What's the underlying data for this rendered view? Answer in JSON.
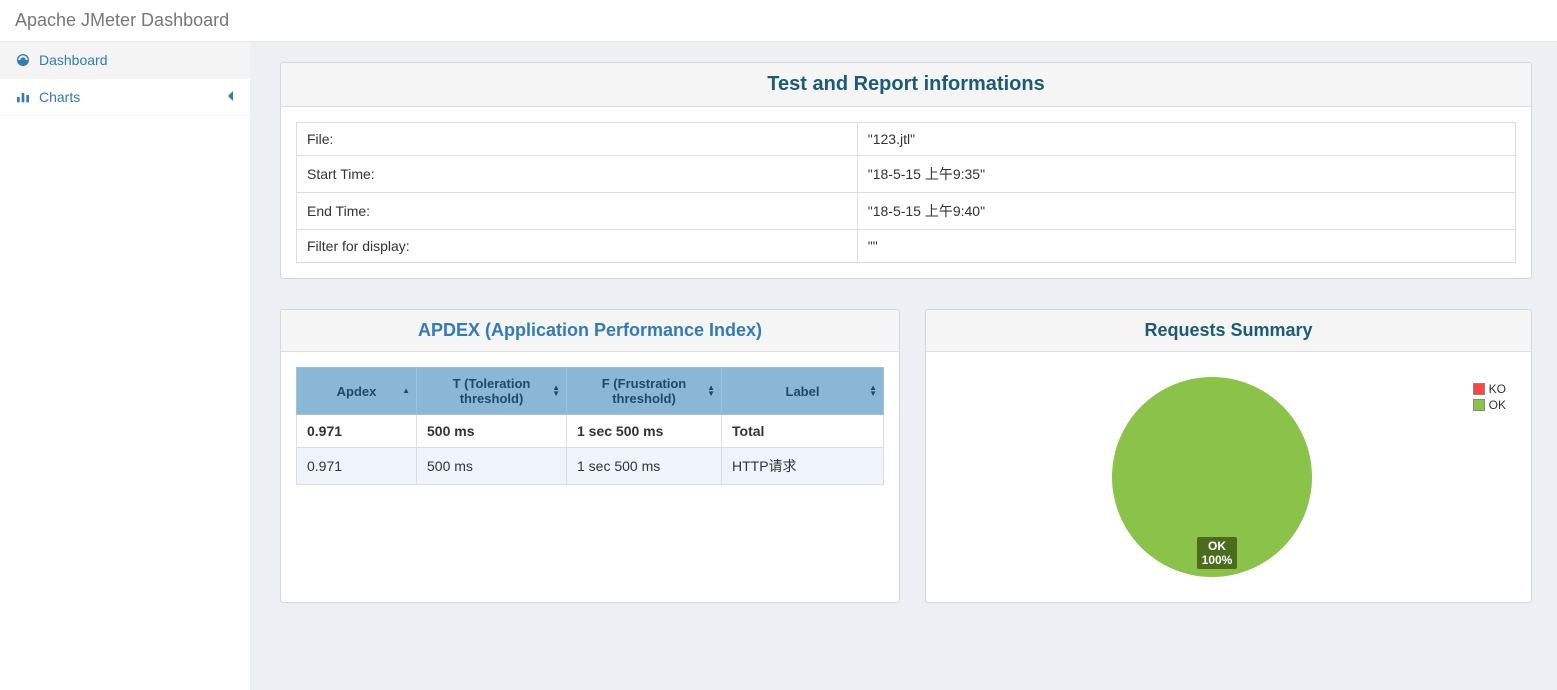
{
  "header": {
    "title": "Apache JMeter Dashboard"
  },
  "sidebar": {
    "dashboard": "Dashboard",
    "charts": "Charts"
  },
  "infoPanel": {
    "title": "Test and Report informations",
    "rows": [
      {
        "label": "File:",
        "value": "\"123.jtl\""
      },
      {
        "label": "Start Time:",
        "value": "\"18-5-15 上午9:35\""
      },
      {
        "label": "End Time:",
        "value": "\"18-5-15 上午9:40\""
      },
      {
        "label": "Filter for display:",
        "value": "\"\""
      }
    ]
  },
  "apdex": {
    "title": "APDEX (Application Performance Index)",
    "headers": {
      "apdex": "Apdex",
      "t": "T (Toleration threshold)",
      "f": "F (Frustration threshold)",
      "label": "Label"
    },
    "rows": [
      {
        "apdex": "0.971",
        "t": "500 ms",
        "f": "1 sec 500 ms",
        "label": "Total"
      },
      {
        "apdex": "0.971",
        "t": "500 ms",
        "f": "1 sec 500 ms",
        "label": "HTTP请求"
      }
    ]
  },
  "summary": {
    "title": "Requests Summary",
    "legend": {
      "ko": "KO",
      "ok": "OK"
    },
    "pieLabelLine1": "OK",
    "pieLabelLine2": "100%"
  },
  "chart_data": {
    "type": "pie",
    "title": "Requests Summary",
    "series": [
      {
        "name": "KO",
        "value": 0,
        "color": "#ff4444"
      },
      {
        "name": "OK",
        "value": 100,
        "color": "#8bc34a"
      }
    ]
  }
}
